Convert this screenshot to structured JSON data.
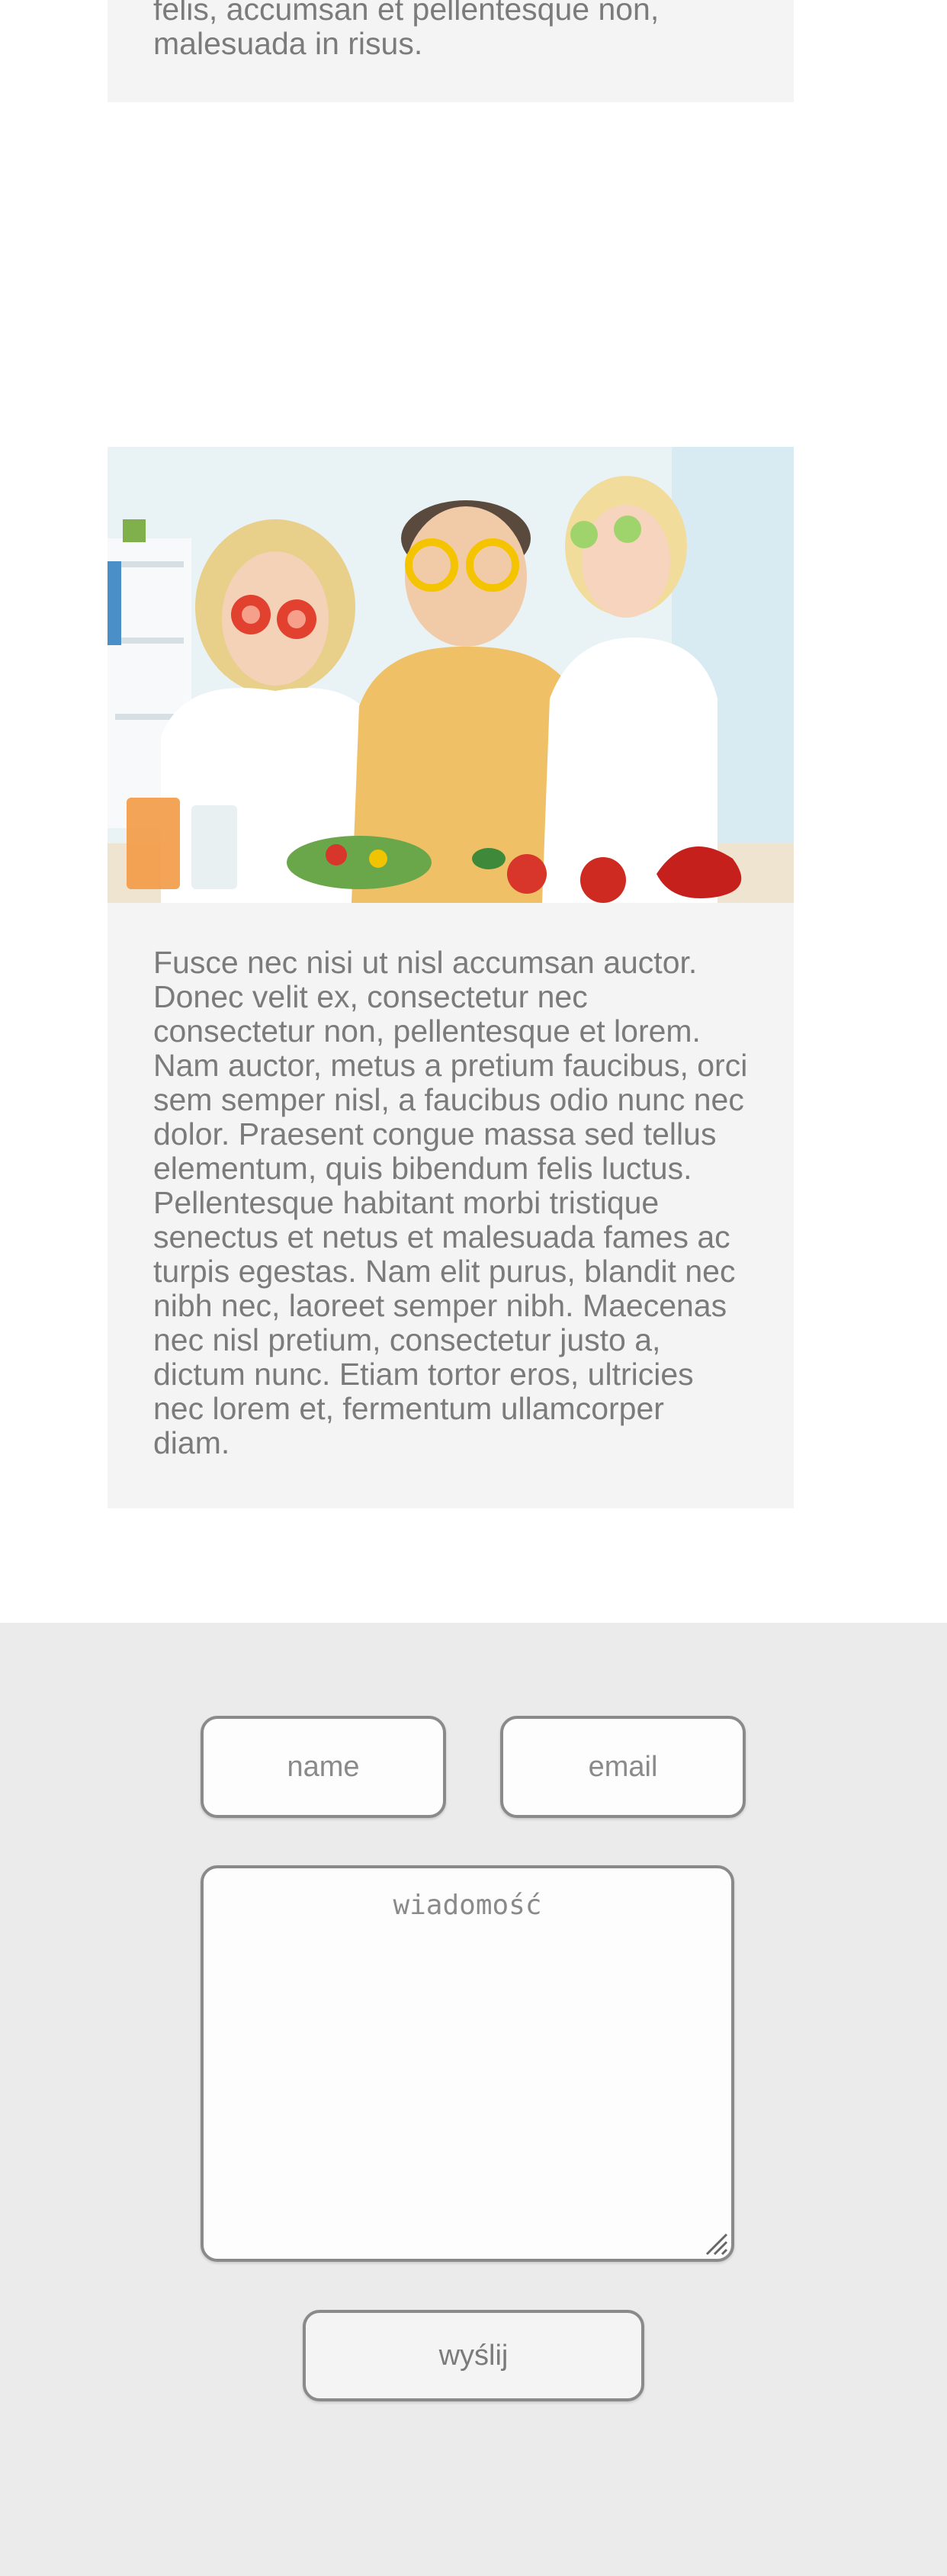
{
  "articles": {
    "top_card": {
      "text": "felis, accumsan et pellentesque non, malesuada in risus."
    },
    "main_card": {
      "image_alt_icon": "family-vegetables-photo",
      "text": "Fusce nec nisi ut nisl accumsan auctor. Donec velit ex, consectetur nec consectetur non, pellentesque et lorem. Nam auctor, metus a pretium faucibus, orci sem semper nisl, a faucibus odio nunc nec dolor. Praesent congue massa sed tellus elementum, quis bibendum felis luctus. Pellentesque habitant morbi tristique senectus et netus et malesuada fames ac turpis egestas. Nam elit purus, blandit nec nibh nec, laoreet semper nibh. Maecenas nec nisl pretium, consectetur justo a, dictum nunc. Etiam tortor eros, ultricies nec lorem et, fermentum ullamcorper diam."
    }
  },
  "contact_form": {
    "name_placeholder": "name",
    "email_placeholder": "email",
    "message_placeholder": "wiadomość",
    "submit_label": "wyślij"
  },
  "colors": {
    "card_background": "#f4f4f4",
    "form_background": "#ebebeb",
    "text": "#7b7b7b",
    "field_border": "#8a8a8a"
  }
}
